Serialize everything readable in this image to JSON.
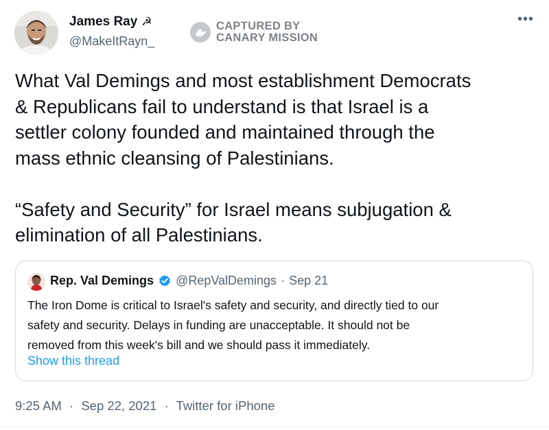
{
  "author": {
    "name": "James Ray",
    "badge_glyph": "☭",
    "handle": "@MakeItRayn_"
  },
  "watermark": {
    "line1": "CAPTURED BY",
    "line2": "CANARY MISSION"
  },
  "more_glyph": "•••",
  "tweet": {
    "lines_p1": [
      "What Val Demings and most establishment Democrats",
      "& Republicans fail to understand is that Israel is a",
      "settler colony founded and maintained through the",
      "mass ethnic cleansing of Palestinians."
    ],
    "lines_p2": [
      "“Safety and Security” for Israel means subjugation &",
      "elimination of all Palestinians."
    ]
  },
  "quote": {
    "name": "Rep. Val Demings",
    "handle": "@RepValDemings",
    "separator": "·",
    "date": "Sep 21",
    "lines": [
      "The Iron Dome is critical to Israel's safety and security, and directly tied to our",
      "safety and security. Delays in funding are unacceptable. It should not be",
      "removed from this week's bill and we should pass it immediately."
    ],
    "show_thread": "Show this thread"
  },
  "meta": {
    "time": "9:25 AM",
    "date": "Sep 22, 2021",
    "source": "Twitter for iPhone",
    "separator": "·"
  },
  "colors": {
    "text_primary": "#0f1419",
    "text_secondary": "#536471",
    "link": "#1d9bf0",
    "verified": "#1d9bf0",
    "border": "#cfd9de"
  }
}
